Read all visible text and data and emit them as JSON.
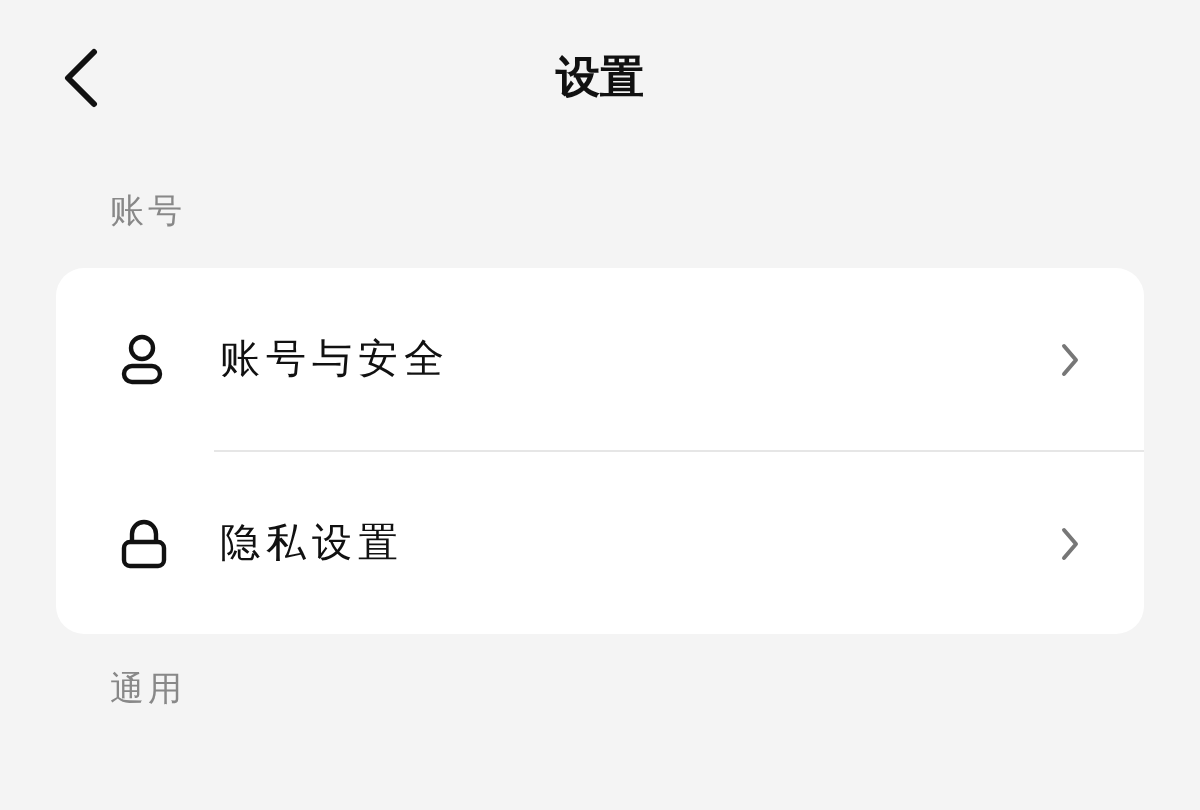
{
  "header": {
    "title": "设置"
  },
  "sections": [
    {
      "title": "账号",
      "items": [
        {
          "label": "账号与安全",
          "kind": "account"
        },
        {
          "label": "隐私设置",
          "kind": "privacy"
        }
      ]
    },
    {
      "title": "通用"
    }
  ]
}
